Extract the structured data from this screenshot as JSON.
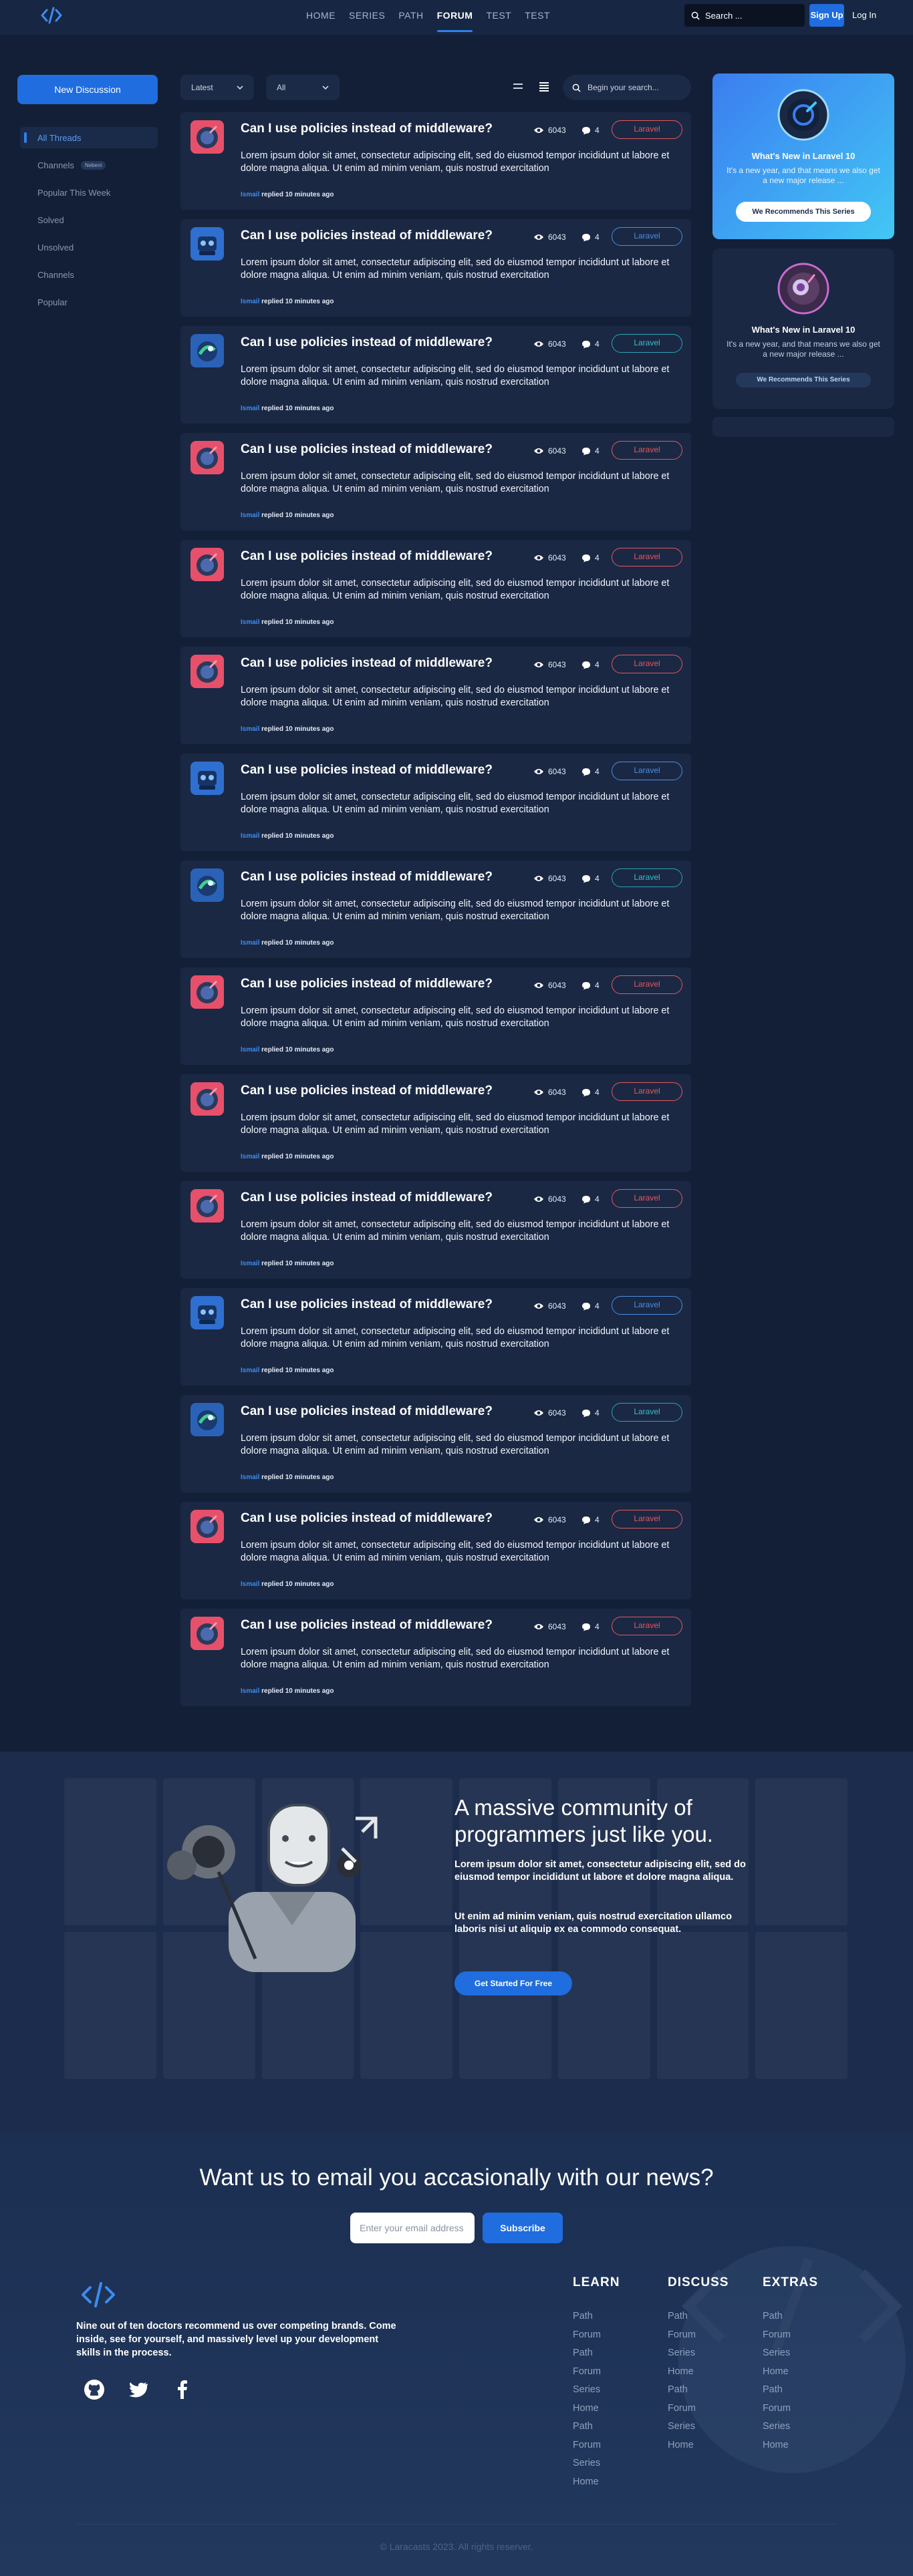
{
  "header": {
    "nav": [
      "HOME",
      "SERIES",
      "PATH",
      "FORUM",
      "TEST",
      "TEST"
    ],
    "active_nav": "FORUM",
    "search_placeholder": "Search ...",
    "signup": "Sign Up",
    "login": "Log In"
  },
  "sidebar": {
    "new_discussion": "New Discussion",
    "items": [
      {
        "label": "All Threads"
      },
      {
        "label": "Channels",
        "badge": "Nebeni"
      },
      {
        "label": "Popular This Week"
      },
      {
        "label": "Solved"
      },
      {
        "label": "Unsolved"
      },
      {
        "label": "Channels"
      },
      {
        "label": "Popular"
      }
    ]
  },
  "filters": {
    "sort": "Latest",
    "scope": "All",
    "search_placeholder": "Begin your search..."
  },
  "threads": [
    {
      "title": "Can I use policies instead of middleware?",
      "views": "6043",
      "replies": "4",
      "tag": "Laravel",
      "tag_style": "red",
      "avatar": "red",
      "body": "Lorem ipsum dolor sit amet, consectetur adipiscing elit, sed do eiusmod tempor incididunt ut labore et dolore magna aliqua. Ut enim ad minim veniam, quis nostrud exercitation",
      "user": "Ismail",
      "meta": "replied 10 minutes ago"
    },
    {
      "title": "Can I use policies instead of middleware?",
      "views": "6043",
      "replies": "4",
      "tag": "Laravel",
      "tag_style": "blue",
      "avatar": "blue",
      "body": "Lorem ipsum dolor sit amet, consectetur adipiscing elit, sed do eiusmod tempor incididunt ut labore et dolore magna aliqua. Ut enim ad minim veniam, quis nostrud exercitation",
      "user": "Ismail",
      "meta": "replied 10 minutes ago"
    },
    {
      "title": "Can I use policies instead of middleware?",
      "views": "6043",
      "replies": "4",
      "tag": "Laravel",
      "tag_style": "teal",
      "avatar": "green",
      "body": "Lorem ipsum dolor sit amet, consectetur adipiscing elit, sed do eiusmod tempor incididunt ut labore et dolore magna aliqua. Ut enim ad minim veniam, quis nostrud exercitation",
      "user": "Ismail",
      "meta": "replied 10 minutes ago"
    },
    {
      "title": "Can I use policies instead of middleware?",
      "views": "6043",
      "replies": "4",
      "tag": "Laravel",
      "tag_style": "red",
      "avatar": "red",
      "body": "Lorem ipsum dolor sit amet, consectetur adipiscing elit, sed do eiusmod tempor incididunt ut labore et dolore magna aliqua. Ut enim ad minim veniam, quis nostrud exercitation",
      "user": "Ismail",
      "meta": "replied 10 minutes ago"
    },
    {
      "title": "Can I use policies instead of middleware?",
      "views": "6043",
      "replies": "4",
      "tag": "Laravel",
      "tag_style": "red",
      "avatar": "red",
      "body": "Lorem ipsum dolor sit amet, consectetur adipiscing elit, sed do eiusmod tempor incididunt ut labore et dolore magna aliqua. Ut enim ad minim veniam, quis nostrud exercitation",
      "user": "Ismail",
      "meta": "replied 10 minutes ago"
    },
    {
      "title": "Can I use policies instead of middleware?",
      "views": "6043",
      "replies": "4",
      "tag": "Laravel",
      "tag_style": "red",
      "avatar": "red",
      "body": "Lorem ipsum dolor sit amet, consectetur adipiscing elit, sed do eiusmod tempor incididunt ut labore et dolore magna aliqua. Ut enim ad minim veniam, quis nostrud exercitation",
      "user": "Ismail",
      "meta": "replied 10 minutes ago"
    },
    {
      "title": "Can I use policies instead of middleware?",
      "views": "6043",
      "replies": "4",
      "tag": "Laravel",
      "tag_style": "blue",
      "avatar": "blue",
      "body": "Lorem ipsum dolor sit amet, consectetur adipiscing elit, sed do eiusmod tempor incididunt ut labore et dolore magna aliqua. Ut enim ad minim veniam, quis nostrud exercitation",
      "user": "Ismail",
      "meta": "replied 10 minutes ago"
    },
    {
      "title": "Can I use policies instead of middleware?",
      "views": "6043",
      "replies": "4",
      "tag": "Laravel",
      "tag_style": "teal",
      "avatar": "green",
      "body": "Lorem ipsum dolor sit amet, consectetur adipiscing elit, sed do eiusmod tempor incididunt ut labore et dolore magna aliqua. Ut enim ad minim veniam, quis nostrud exercitation",
      "user": "Ismail",
      "meta": "replied 10 minutes ago"
    },
    {
      "title": "Can I use policies instead of middleware?",
      "views": "6043",
      "replies": "4",
      "tag": "Laravel",
      "tag_style": "red",
      "avatar": "red",
      "body": "Lorem ipsum dolor sit amet, consectetur adipiscing elit, sed do eiusmod tempor incididunt ut labore et dolore magna aliqua. Ut enim ad minim veniam, quis nostrud exercitation",
      "user": "Ismail",
      "meta": "replied 10 minutes ago"
    },
    {
      "title": "Can I use policies instead of middleware?",
      "views": "6043",
      "replies": "4",
      "tag": "Laravel",
      "tag_style": "red",
      "avatar": "red",
      "body": "Lorem ipsum dolor sit amet, consectetur adipiscing elit, sed do eiusmod tempor incididunt ut labore et dolore magna aliqua. Ut enim ad minim veniam, quis nostrud exercitation",
      "user": "Ismail",
      "meta": "replied 10 minutes ago"
    },
    {
      "title": "Can I use policies instead of middleware?",
      "views": "6043",
      "replies": "4",
      "tag": "Laravel",
      "tag_style": "red",
      "avatar": "red",
      "body": "Lorem ipsum dolor sit amet, consectetur adipiscing elit, sed do eiusmod tempor incididunt ut labore et dolore magna aliqua. Ut enim ad minim veniam, quis nostrud exercitation",
      "user": "Ismail",
      "meta": "replied 10 minutes ago"
    },
    {
      "title": "Can I use policies instead of middleware?",
      "views": "6043",
      "replies": "4",
      "tag": "Laravel",
      "tag_style": "blue",
      "avatar": "blue",
      "body": "Lorem ipsum dolor sit amet, consectetur adipiscing elit, sed do eiusmod tempor incididunt ut labore et dolore magna aliqua. Ut enim ad minim veniam, quis nostrud exercitation",
      "user": "Ismail",
      "meta": "replied 10 minutes ago"
    },
    {
      "title": "Can I use policies instead of middleware?",
      "views": "6043",
      "replies": "4",
      "tag": "Laravel",
      "tag_style": "teal",
      "avatar": "green",
      "body": "Lorem ipsum dolor sit amet, consectetur adipiscing elit, sed do eiusmod tempor incididunt ut labore et dolore magna aliqua. Ut enim ad minim veniam, quis nostrud exercitation",
      "user": "Ismail",
      "meta": "replied 10 minutes ago"
    },
    {
      "title": "Can I use policies instead of middleware?",
      "views": "6043",
      "replies": "4",
      "tag": "Laravel",
      "tag_style": "red",
      "avatar": "red",
      "body": "Lorem ipsum dolor sit amet, consectetur adipiscing elit, sed do eiusmod tempor incididunt ut labore et dolore magna aliqua. Ut enim ad minim veniam, quis nostrud exercitation",
      "user": "Ismail",
      "meta": "replied 10 minutes ago"
    },
    {
      "title": "Can I use policies instead of middleware?",
      "views": "6043",
      "replies": "4",
      "tag": "Laravel",
      "tag_style": "red",
      "avatar": "red",
      "body": "Lorem ipsum dolor sit amet, consectetur adipiscing elit, sed do eiusmod tempor incididunt ut labore et dolore magna aliqua. Ut enim ad minim veniam, quis nostrud exercitation",
      "user": "Ismail",
      "meta": "replied 10 minutes ago"
    }
  ],
  "promo": {
    "card1": {
      "title": "What's New in Laravel 10",
      "text": "It's a new year, and that means we also get a new major release ...",
      "button": "We Recommends This Series"
    },
    "card2": {
      "title": "What's New in Laravel 10",
      "text": "It's a new year, and that means we also get a new major release ...",
      "button": "We Recommends This Series"
    }
  },
  "community": {
    "title": "A massive community of programmers just like you.",
    "p1": "Lorem ipsum dolor sit amet, consectetur adipiscing elit, sed do eiusmod tempor incididunt ut labore et dolore magna aliqua.",
    "p2": "Ut enim ad minim veniam, quis nostrud exercitation ullamco laboris nisi ut aliquip ex ea commodo consequat.",
    "button": "Get Started For Free"
  },
  "footer": {
    "title": "Want us to email you accasionally with our news?",
    "email_placeholder": "Enter your email address",
    "subscribe": "Subscribe",
    "tagline": "Nine out of ten doctors recommend us over competing brands. Come inside, see for yourself, and massively level up your development skills in the process.",
    "columns": [
      {
        "heading": "LEARN",
        "links": [
          "Path",
          "Forum",
          "Path",
          "Forum",
          "Series",
          "Home",
          "Path",
          "Forum",
          "Series",
          "Home"
        ]
      },
      {
        "heading": "DISCUSS",
        "links": [
          "Path",
          "Forum",
          "Series",
          "Home",
          "Path",
          "Forum",
          "Series",
          "Home"
        ]
      },
      {
        "heading": "EXTRAS",
        "links": [
          "Path",
          "Forum",
          "Series",
          "Home",
          "Path",
          "Forum",
          "Series",
          "Home"
        ]
      }
    ],
    "copyright": "© Laracasts 2023. All rights reserver."
  },
  "colors": {
    "accent": "#1f6ddf",
    "background": "#131f36",
    "card": "#1a2844",
    "tag_red": "#e5575f",
    "tag_blue": "#4a8fe0",
    "tag_teal": "#2aa5b5"
  }
}
